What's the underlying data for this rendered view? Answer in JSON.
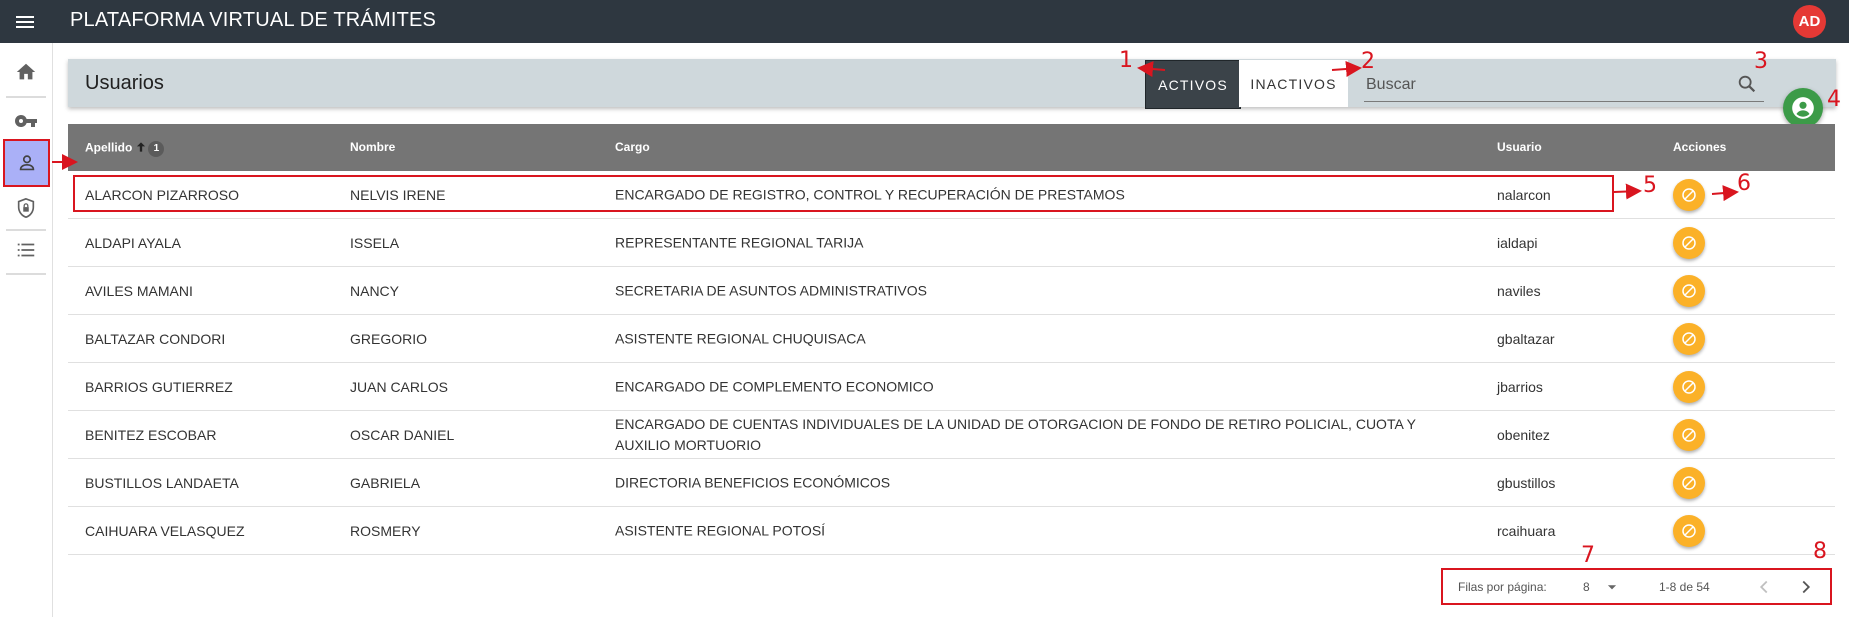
{
  "app": {
    "title": "PLATAFORMA VIRTUAL DE TRÁMITES",
    "user_initials": "AD"
  },
  "sidebar": {
    "items": [
      {
        "icon": "home-icon"
      },
      {
        "icon": "key-icon"
      },
      {
        "icon": "person-icon",
        "active": true
      },
      {
        "icon": "shield-lock-icon"
      },
      {
        "icon": "list-icon"
      }
    ]
  },
  "header": {
    "title": "Usuarios",
    "tabs": [
      {
        "label": "ACTIVOS",
        "active": true
      },
      {
        "label": "INACTIVOS"
      }
    ],
    "search_placeholder": "Buscar"
  },
  "table": {
    "columns": [
      "Apellido",
      "Nombre",
      "Cargo",
      "Usuario",
      "Acciones"
    ],
    "sort_order": "1",
    "rows": [
      {
        "apellido": "ALARCON PIZARROSO",
        "nombre": "NELVIS IRENE",
        "cargo": "ENCARGADO DE REGISTRO, CONTROL Y RECUPERACIÓN DE PRESTAMOS",
        "usuario": "nalarcon"
      },
      {
        "apellido": "ALDAPI AYALA",
        "nombre": "ISSELA",
        "cargo": "REPRESENTANTE REGIONAL TARIJA",
        "usuario": "ialdapi"
      },
      {
        "apellido": "AVILES MAMANI",
        "nombre": "NANCY",
        "cargo": "SECRETARIA DE ASUNTOS ADMINISTRATIVOS",
        "usuario": "naviles"
      },
      {
        "apellido": "BALTAZAR CONDORI",
        "nombre": "GREGORIO",
        "cargo": "ASISTENTE REGIONAL CHUQUISACA",
        "usuario": "gbaltazar"
      },
      {
        "apellido": "BARRIOS GUTIERREZ",
        "nombre": "JUAN CARLOS",
        "cargo": "ENCARGADO DE COMPLEMENTO ECONOMICO",
        "usuario": "jbarrios"
      },
      {
        "apellido": "BENITEZ ESCOBAR",
        "nombre": "OSCAR DANIEL",
        "cargo": "ENCARGADO DE CUENTAS INDIVIDUALES DE LA UNIDAD DE OTORGACION DE FONDO DE RETIRO POLICIAL, CUOTA Y AUXILIO MORTUORIO",
        "usuario": "obenitez"
      },
      {
        "apellido": "BUSTILLOS LANDAETA",
        "nombre": "GABRIELA",
        "cargo": "DIRECTORIA BENEFICIOS ECONÓMICOS",
        "usuario": "gbustillos"
      },
      {
        "apellido": "CAIHUARA VELASQUEZ",
        "nombre": "ROSMERY",
        "cargo": "ASISTENTE REGIONAL POTOSÍ",
        "usuario": "rcaihuara"
      }
    ]
  },
  "footer": {
    "rows_per_page_label": "Filas por página:",
    "rows_per_page": "8",
    "range": "1-8 de 54"
  },
  "annotations": [
    "1",
    "2",
    "3",
    "4",
    "5",
    "6",
    "7",
    "8"
  ],
  "colors": {
    "topbar": "#2e3740",
    "header": "#cfd8dc",
    "table_header": "#757575",
    "action": "#fbb128",
    "fab": "#3c9b48",
    "annotation": "#d9151f",
    "active_nav": "#aab0f7"
  }
}
